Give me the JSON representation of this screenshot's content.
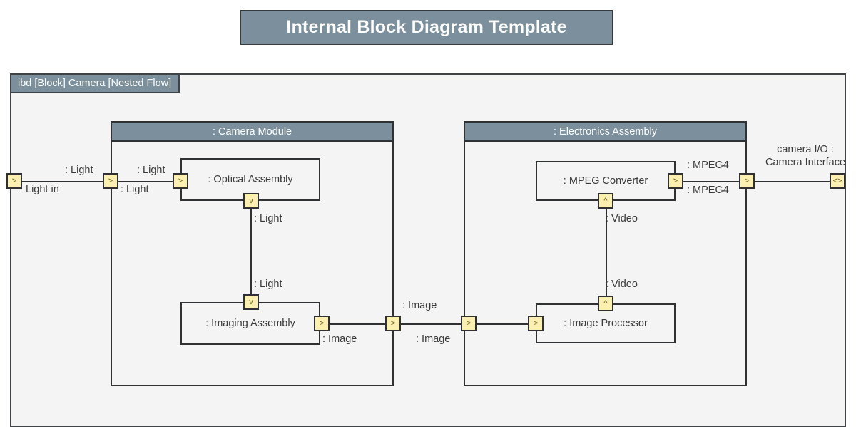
{
  "title": {
    "text": "Internal Block Diagram Template"
  },
  "frame": {
    "label": "ibd [Block] Camera [Nested Flow]"
  },
  "parts": {
    "camera_module": {
      "name": ": Camera Module"
    },
    "electronics_assembly": {
      "name": ": Electronics Assembly"
    },
    "optical_assembly": {
      "name": ": Optical Assembly"
    },
    "imaging_assembly": {
      "name": ": Imaging Assembly"
    },
    "mpeg_converter": {
      "name": ": MPEG Converter"
    },
    "image_processor": {
      "name": ": Image Processor"
    }
  },
  "ports": {
    "frame_light_in": {
      "glyph": ">",
      "label": "Light in"
    },
    "camera_module_light_in": {
      "glyph": ">"
    },
    "optical_assembly_light_in": {
      "glyph": ">"
    },
    "optical_assembly_light_out": {
      "glyph": "v"
    },
    "imaging_assembly_light_in": {
      "glyph": "v"
    },
    "imaging_assembly_image_out": {
      "glyph": ">"
    },
    "camera_module_image_out": {
      "glyph": ">"
    },
    "electronics_assembly_image_in": {
      "glyph": ">"
    },
    "image_processor_image_in": {
      "glyph": ">"
    },
    "image_processor_video_out": {
      "glyph": "^"
    },
    "mpeg_converter_video_in": {
      "glyph": "^"
    },
    "mpeg_converter_mpeg4_out": {
      "glyph": ">"
    },
    "electronics_assembly_mpeg4_out": {
      "glyph": ">"
    },
    "frame_camera_io": {
      "glyph": "<>"
    }
  },
  "flow_labels": {
    "light_frame_to_module_top": ": Light",
    "light_module_to_optical_top": ": Light",
    "light_frame_to_module_bottom": ": Light",
    "light_optical_down_top": ": Light",
    "light_optical_down_bottom": ": Light",
    "image_imaging_out": ": Image",
    "image_module_out_top": ": Image",
    "image_module_out_bottom": ": Image",
    "video_mpeg_in": ": Video",
    "video_processor_out": ": Video",
    "mpeg4_converter_out_top": ": MPEG4",
    "mpeg4_converter_out_bottom": ": MPEG4",
    "camera_io_line1": "camera I/O :",
    "camera_io_line2": "Camera Interface"
  },
  "colors": {
    "header_fill": "#7b909c",
    "port_fill": "#fcf0b0",
    "frame_fill": "#f4f4f4",
    "stroke": "#2f3133",
    "text": "#3a3a3a"
  }
}
